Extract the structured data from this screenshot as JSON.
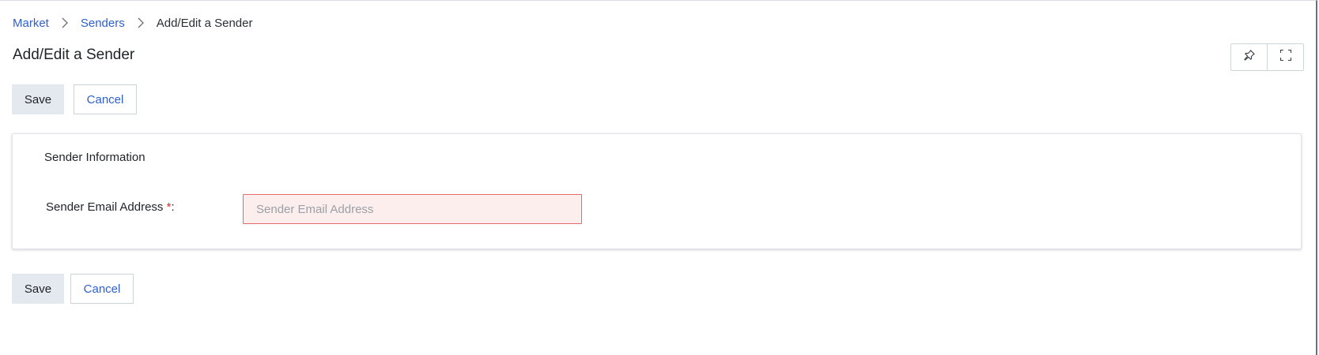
{
  "breadcrumb": {
    "items": [
      {
        "label": "Market"
      },
      {
        "label": "Senders"
      }
    ],
    "current": "Add/Edit a Sender"
  },
  "page": {
    "title": "Add/Edit a Sender"
  },
  "header_tools": {
    "pin_icon": "pin-icon",
    "fullscreen_icon": "fullscreen-icon"
  },
  "actions": {
    "save_label": "Save",
    "cancel_label": "Cancel"
  },
  "sender_info": {
    "title": "Sender Information",
    "email_label": "Sender Email Address",
    "required_marker": "*",
    "label_suffix": ":",
    "email_value": "",
    "email_placeholder": "Sender Email Address"
  },
  "colors": {
    "link": "#2f5fcf",
    "save_bg": "#e4e9ef",
    "error_border": "#e36b6b",
    "error_bg": "#fdeeee",
    "required": "#d0312d"
  }
}
